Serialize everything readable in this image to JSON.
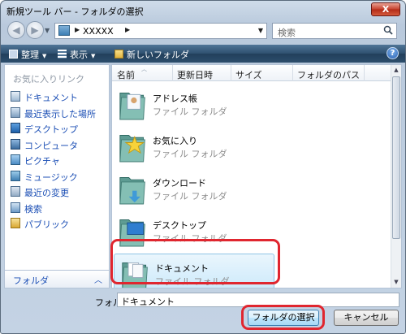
{
  "window": {
    "title": "新規ツール バー - フォルダの選択",
    "close_label": "X"
  },
  "address": {
    "path": "XXXXX",
    "refresh_glyph": "↻",
    "search_placeholder": "検索"
  },
  "toolbar": {
    "organize_label": "整理",
    "view_label": "表示",
    "new_folder_label": "新しいフォルダ",
    "help_label": "?"
  },
  "navpane": {
    "header": "お気に入りリンク",
    "items": [
      {
        "label": "ドキュメント",
        "icon": "documents-icon"
      },
      {
        "label": "最近表示した場所",
        "icon": "recent-places-icon"
      },
      {
        "label": "デスクトップ",
        "icon": "desktop-icon"
      },
      {
        "label": "コンピュータ",
        "icon": "computer-icon"
      },
      {
        "label": "ピクチャ",
        "icon": "pictures-icon"
      },
      {
        "label": "ミュージック",
        "icon": "music-icon"
      },
      {
        "label": "最近の変更",
        "icon": "recent-changes-icon"
      },
      {
        "label": "検索",
        "icon": "search-folder-icon"
      },
      {
        "label": "パブリック",
        "icon": "public-icon"
      }
    ],
    "folder_bar_label": "フォルダ",
    "folder_bar_chevron": "︿"
  },
  "columns": [
    "名前",
    "更新日時",
    "サイズ",
    "フォルダのパス"
  ],
  "files": [
    {
      "name": "アドレス帳",
      "type": "ファイル フォルダ",
      "icon": "contacts-folder-icon"
    },
    {
      "name": "お気に入り",
      "type": "ファイル フォルダ",
      "icon": "favorites-folder-icon"
    },
    {
      "name": "ダウンロード",
      "type": "ファイル フォルダ",
      "icon": "downloads-folder-icon"
    },
    {
      "name": "デスクトップ",
      "type": "ファイル フォルダ",
      "icon": "desktop-folder-icon"
    },
    {
      "name": "ドキュメント",
      "type": "ファイル フォルダ",
      "icon": "documents-folder-icon",
      "selected": true
    }
  ],
  "footer": {
    "folder_label": "フォルダ:",
    "folder_value": "ドキュメント",
    "select_button": "フォルダの選択",
    "cancel_button": "キャンセル"
  },
  "colors": {
    "highlight": "#e0262f",
    "link": "#1c4fb5",
    "toolbar": "#2e506f",
    "selection": "#c9e8fa"
  }
}
